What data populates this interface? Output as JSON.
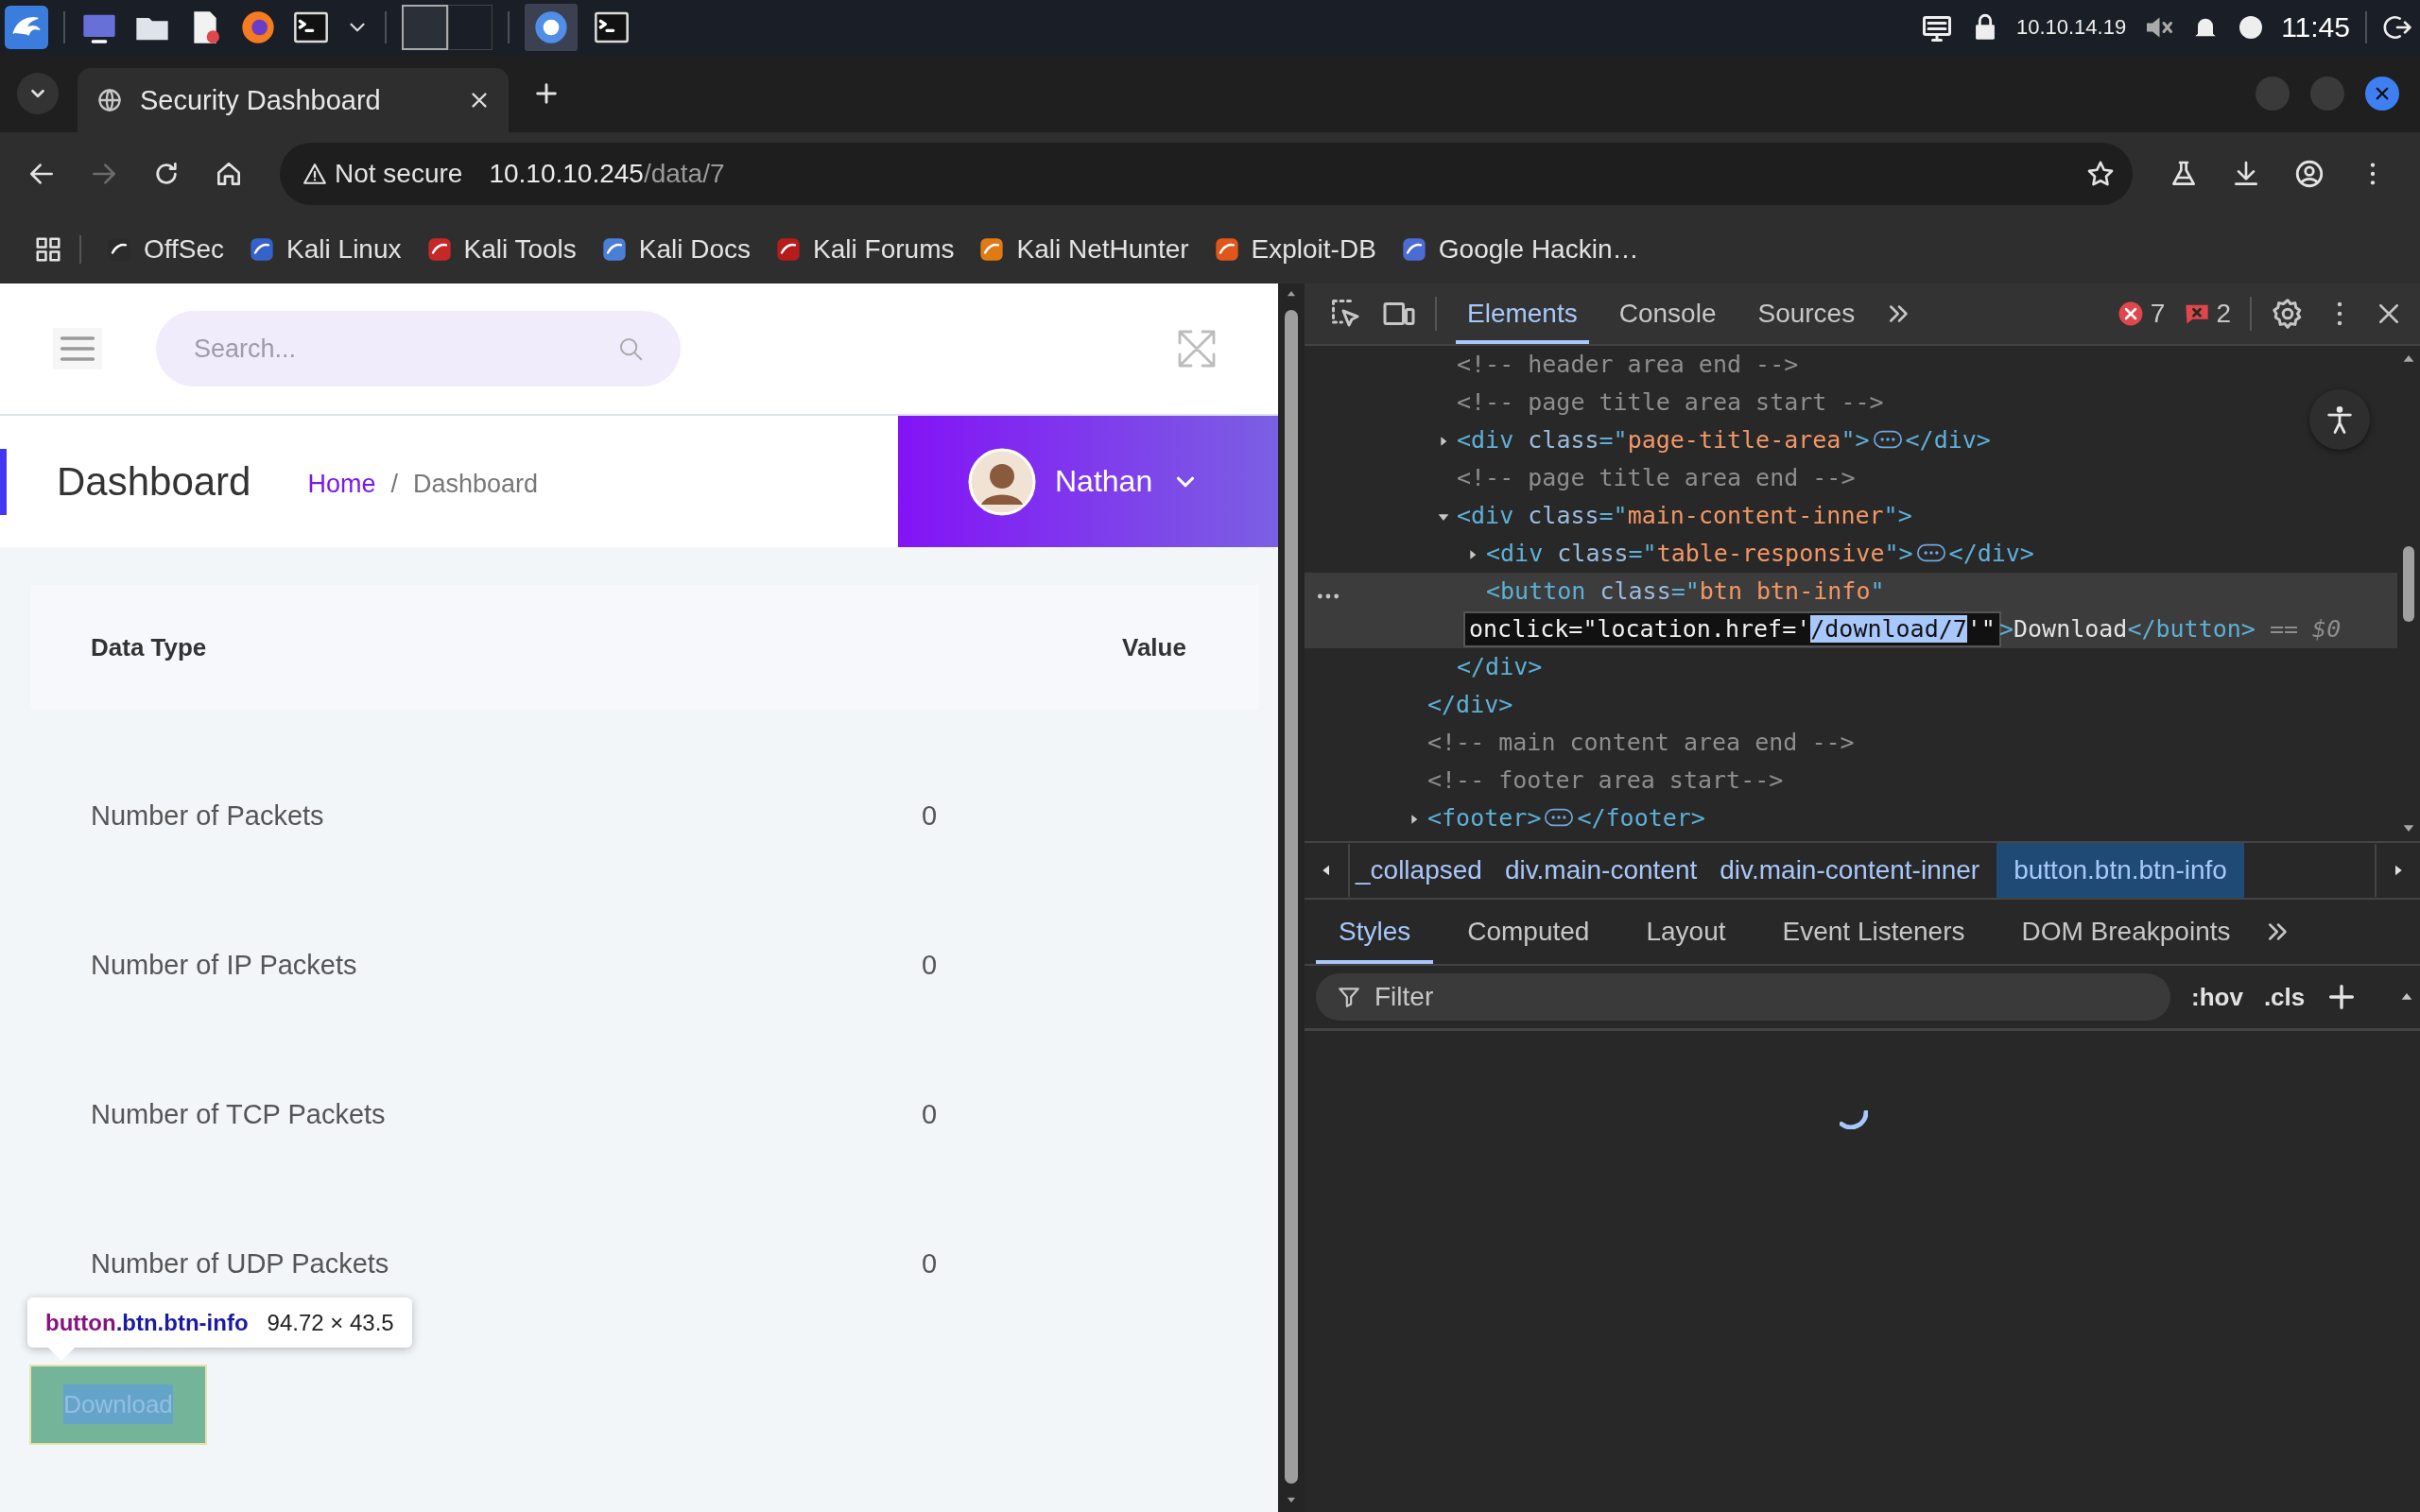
{
  "taskbar": {
    "ip_address": "10.10.14.19",
    "clock": "11:45"
  },
  "browser": {
    "tabs": [
      {
        "title": "Security Dashboard",
        "selected": true
      }
    ],
    "address_bar": {
      "security_chip": "Not secure",
      "host": "10.10.10.245",
      "path": "/data/7"
    },
    "bookmarks": [
      {
        "label": "OffSec"
      },
      {
        "label": "Kali Linux"
      },
      {
        "label": "Kali Tools"
      },
      {
        "label": "Kali Docs"
      },
      {
        "label": "Kali Forums"
      },
      {
        "label": "Kali NetHunter"
      },
      {
        "label": "Exploit-DB"
      },
      {
        "label": "Google Hackin…"
      }
    ]
  },
  "page": {
    "search": {
      "placeholder": "Search..."
    },
    "title": "Dashboard",
    "breadcrumb": [
      {
        "label": "Home",
        "kind": "link"
      },
      {
        "label": "Dashboard",
        "kind": "current"
      }
    ],
    "breadcrumb_separator": "/",
    "user": {
      "name": "Nathan"
    },
    "table": {
      "columns": [
        "Data Type",
        "Value"
      ],
      "rows": [
        [
          "Number of Packets",
          "0"
        ],
        [
          "Number of IP Packets",
          "0"
        ],
        [
          "Number of TCP Packets",
          "0"
        ],
        [
          "Number of UDP Packets",
          "0"
        ]
      ]
    },
    "download_button": {
      "label": "Download",
      "inspected": true
    },
    "inspect_tooltip": {
      "tag": "button",
      "classes": ".btn.btn-info",
      "size": "94.72 × 43.5"
    }
  },
  "devtools": {
    "tabs": [
      {
        "label": "Elements",
        "selected": true
      },
      {
        "label": "Console",
        "selected": false
      },
      {
        "label": "Sources",
        "selected": false
      }
    ],
    "error_count": "7",
    "warning_count": "2",
    "dom_tree": [
      {
        "kind": "continued",
        "selected": false,
        "close": "</div>",
        "children": [
          {
            "kind": "comment",
            "selected": false,
            "text": "<!-- header area end -->"
          },
          {
            "kind": "comment",
            "selected": false,
            "text": "<!-- page title area start -->"
          },
          {
            "kind": "element",
            "selected": false,
            "expanded": false,
            "open": "<div class=\"page-title-area\">",
            "close": "</div>"
          },
          {
            "kind": "comment",
            "selected": false,
            "text": "<!-- page title area end -->"
          },
          {
            "kind": "element",
            "selected": false,
            "expanded": true,
            "open": "<div class=\"main-content-inner\">",
            "close": "</div>",
            "children": [
              {
                "kind": "element",
                "selected": false,
                "expanded": false,
                "open": "<div class=\"table-responsive\">",
                "close": "</div>"
              },
              {
                "kind": "leaf",
                "selected": true,
                "segments": [
                  {
                    "kind": "markup",
                    "text": "<button class=\"btn btn-info\" "
                  },
                  {
                    "kind": "editor",
                    "parts": [
                      {
                        "text": "onclick=\"location.href='",
                        "selected": false
                      },
                      {
                        "text": "/download/7",
                        "selected": true
                      },
                      {
                        "text": "'\"",
                        "selected": false
                      }
                    ]
                  },
                  {
                    "kind": "markup",
                    "text": ">"
                  },
                  {
                    "kind": "text",
                    "text": "Download"
                  },
                  {
                    "kind": "markup",
                    "text": "</button>"
                  },
                  {
                    "kind": "ref",
                    "text": " == $0"
                  }
                ]
              }
            ]
          }
        ]
      },
      {
        "kind": "comment",
        "selected": false,
        "text": "<!-- main content area end -->"
      },
      {
        "kind": "comment",
        "selected": false,
        "text": "<!-- footer area start-->"
      },
      {
        "kind": "element",
        "selected": false,
        "expanded": false,
        "open": "<footer>",
        "close": "</footer>"
      }
    ],
    "breadcrumbs": [
      {
        "label": "_collapsed",
        "selected": false
      },
      {
        "label": "div.main-content",
        "selected": false
      },
      {
        "label": "div.main-content-inner",
        "selected": false
      },
      {
        "label": "button.btn.btn-info",
        "selected": true
      }
    ],
    "pane_tabs": [
      {
        "label": "Styles",
        "selected": true
      },
      {
        "label": "Computed",
        "selected": false
      },
      {
        "label": "Layout",
        "selected": false
      },
      {
        "label": "Event Listeners",
        "selected": false
      },
      {
        "label": "DOM Breakpoints",
        "selected": false
      }
    ],
    "filter": {
      "placeholder": "Filter"
    },
    "style_buttons": [
      ":hov",
      ".cls"
    ],
    "loading": true
  }
}
